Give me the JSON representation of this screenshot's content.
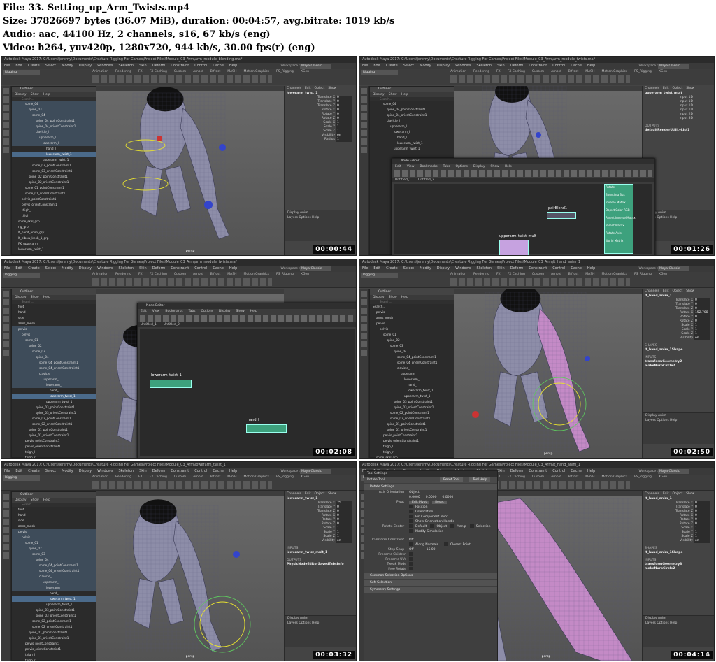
{
  "header": {
    "file": "File: 33. Setting_up_Arm_Twists.mp4",
    "size": "Size: 37826697 bytes (36.07 MiB), duration: 00:04:57, avg.bitrate: 1019 kb/s",
    "audio": "Audio: aac, 44100 Hz, 2 channels, s16, 67 kb/s (eng)",
    "video": "Video: h264, yuv420p, 1280x720, 944 kb/s, 30.00 fps(r) (eng)"
  },
  "maya": {
    "title_prefix": "Autodesk Maya 2017: C:\\Users\\jeremy\\Documents\\Creature Rigging For Games\\Project Files\\Module_03_Arm\\",
    "menus": [
      "File",
      "Edit",
      "Create",
      "Select",
      "Modify",
      "Display",
      "Windows",
      "Skeleton",
      "Skin",
      "Deform",
      "Constraint",
      "Control",
      "Cache",
      "Help"
    ],
    "shelf_tabs": [
      "Animation",
      "Rendering",
      "FX",
      "FX Caching",
      "Custom",
      "Arnold",
      "Bifrost",
      "MASH",
      "Motion Graphics",
      "PS_Rigging",
      "XGen"
    ],
    "mode": "Rigging",
    "workspace_label": "Workspace :",
    "workspace": "Maya Classic",
    "no_live": "No Live Surface",
    "outliner_title": "Outliner",
    "outliner_menu": [
      "Display",
      "Show",
      "Help"
    ],
    "search": "Search...",
    "viewport_label": "persp",
    "channel_menu": [
      "Channels",
      "Edit",
      "Object",
      "Show"
    ],
    "layer_tabs": [
      "Display",
      "Anim"
    ],
    "layer_menu": [
      "Layers",
      "Options",
      "Help"
    ],
    "attrs": [
      "Translate X",
      "Translate Y",
      "Translate Z",
      "Rotate X",
      "Rotate Y",
      "Rotate Z",
      "Scale X",
      "Scale Y",
      "Scale Z",
      "Visibility"
    ]
  },
  "thumbs": [
    {
      "timecode": "00:00:44",
      "file_tail": "arm_module_blending.ma*",
      "sel_obj": "lowerarm_twist_1",
      "chan_obj": "lowerarm_twist_1",
      "values": [
        "0",
        "0",
        "0",
        "0",
        "0",
        "0",
        "1",
        "1",
        "1",
        "on"
      ],
      "extra_attr": "Radius",
      "extra_val": "1",
      "outliner": [
        {
          "t": "spine_04",
          "d": 3,
          "c": "hi"
        },
        {
          "t": "spine_03",
          "d": 4,
          "c": "hi"
        },
        {
          "t": "spine_04",
          "d": 5,
          "c": "hi"
        },
        {
          "t": "spine_04_pointConstraint1",
          "d": 6,
          "c": "hi"
        },
        {
          "t": "spine_04_orientConstraint1",
          "d": 6,
          "c": "hi"
        },
        {
          "t": "clavicle_l",
          "d": 6,
          "c": "hi"
        },
        {
          "t": "upperarm_l",
          "d": 7,
          "c": "hi"
        },
        {
          "t": "lowerarm_l",
          "d": 8,
          "c": "hi"
        },
        {
          "t": "hand_l",
          "d": 9,
          "c": ""
        },
        {
          "t": "lowerarm_twist_1",
          "d": 9,
          "c": "sel"
        },
        {
          "t": "upperarm_twist_1",
          "d": 8,
          "c": ""
        },
        {
          "t": "spine_03_pointConstraint1",
          "d": 5,
          "c": ""
        },
        {
          "t": "spine_03_orientConstraint1",
          "d": 5,
          "c": ""
        },
        {
          "t": "spine_02_pointConstraint1",
          "d": 4,
          "c": ""
        },
        {
          "t": "spine_02_orientConstraint1",
          "d": 4,
          "c": ""
        },
        {
          "t": "spine_01_pointConstraint1",
          "d": 3,
          "c": ""
        },
        {
          "t": "spine_01_orientConstraint1",
          "d": 3,
          "c": ""
        },
        {
          "t": "pelvis_pointConstraint1",
          "d": 2,
          "c": ""
        },
        {
          "t": "pelvis_orientConstraint1",
          "d": 2,
          "c": ""
        },
        {
          "t": "thigh_l",
          "d": 2,
          "c": ""
        },
        {
          "t": "thigh_r",
          "d": 2,
          "c": ""
        },
        {
          "t": "spine_skel_grp",
          "d": 1,
          "c": ""
        },
        {
          "t": "rig_grp",
          "d": 1,
          "c": ""
        },
        {
          "t": "lt_hand_anim_grp1",
          "d": 1,
          "c": ""
        },
        {
          "t": "lt_elbow_knob_1_grp",
          "d": 1,
          "c": ""
        },
        {
          "t": "FK_upperarm",
          "d": 1,
          "c": ""
        },
        {
          "t": "lowerarm_twist_1",
          "d": 1,
          "c": ""
        }
      ]
    },
    {
      "timecode": "00:01:26",
      "file_tail": "arm_module_twists.ma*",
      "sel_obj": "upperarm_twist_mult",
      "chan_obj": "upperarm_twist_mult",
      "inputs": [
        "Input 1D",
        "Input 1D",
        "Input 1D",
        "Input 1D",
        "Input 2D",
        "Input 3D"
      ],
      "outputs_label": "OUTPUTS",
      "outputs_node": "defaultRenderUtilityList1",
      "node_editor_title": "Node Editor",
      "node_editor_menus": [
        "Edit",
        "View",
        "Bookmarks",
        "Tabs",
        "Options",
        "Display",
        "Show",
        "Help"
      ],
      "node_tabs": [
        "Untitled_1",
        "Untitled_2"
      ],
      "nodes": [
        "pairBlend1",
        "upperarm_twist_mult",
        "Rotate",
        "Bounding Box",
        "Inverse Matrix",
        "Object Color RGB",
        "Parent Inverse Matrix",
        "Parent Matrix",
        "Rotate Axis",
        "World Matrix"
      ]
    },
    {
      "timecode": "00:02:08",
      "file_tail": "arm_module_twists.ma*",
      "node_editor_title": "Node Editor",
      "node_editor_menus": [
        "Edit",
        "View",
        "Bookmarks",
        "Tabs",
        "Options",
        "Display",
        "Show",
        "Help"
      ],
      "node_tabs": [
        "Untitled_1",
        "Untitled_2"
      ],
      "node1": "lowerarm_twist_1",
      "node2": "hand_l",
      "outliner": [
        {
          "t": "foot",
          "d": 1,
          "c": ""
        },
        {
          "t": "hand",
          "d": 1,
          "c": ""
        },
        {
          "t": "side",
          "d": 1,
          "c": ""
        },
        {
          "t": "arms_mesh",
          "d": 1,
          "c": ""
        },
        {
          "t": "pelvis",
          "d": 1,
          "c": "hi"
        },
        {
          "t": "pelvis",
          "d": 2,
          "c": "hi"
        },
        {
          "t": "spine_01",
          "d": 3,
          "c": "hi"
        },
        {
          "t": "spine_02",
          "d": 4,
          "c": "hi"
        },
        {
          "t": "spine_03",
          "d": 5,
          "c": "hi"
        },
        {
          "t": "spine_04",
          "d": 6,
          "c": "hi"
        },
        {
          "t": "spine_04_pointConstraint1",
          "d": 7,
          "c": "hi"
        },
        {
          "t": "spine_04_orientConstraint1",
          "d": 7,
          "c": "hi"
        },
        {
          "t": "clavicle_l",
          "d": 7,
          "c": "hi"
        },
        {
          "t": "upperarm_l",
          "d": 8,
          "c": "hi"
        },
        {
          "t": "lowerarm_l",
          "d": 9,
          "c": "hi"
        },
        {
          "t": "hand_l",
          "d": 10,
          "c": ""
        },
        {
          "t": "lowerarm_twist_1",
          "d": 10,
          "c": "sel"
        },
        {
          "t": "upperarm_twist_1",
          "d": 9,
          "c": ""
        },
        {
          "t": "spine_03_pointConstraint1",
          "d": 6,
          "c": ""
        },
        {
          "t": "spine_03_orientConstraint1",
          "d": 6,
          "c": ""
        },
        {
          "t": "spine_02_pointConstraint1",
          "d": 5,
          "c": ""
        },
        {
          "t": "spine_02_orientConstraint1",
          "d": 5,
          "c": ""
        },
        {
          "t": "spine_01_pointConstraint1",
          "d": 4,
          "c": ""
        },
        {
          "t": "spine_01_orientConstraint1",
          "d": 4,
          "c": ""
        },
        {
          "t": "pelvis_pointConstraint1",
          "d": 3,
          "c": ""
        },
        {
          "t": "pelvis_orientConstraint1",
          "d": 3,
          "c": ""
        },
        {
          "t": "thigh_l",
          "d": 3,
          "c": ""
        },
        {
          "t": "thigh_r",
          "d": 3,
          "c": ""
        },
        {
          "t": "spine_skel_grp",
          "d": 1,
          "c": ""
        }
      ]
    },
    {
      "timecode": "00:02:50",
      "file_tail": "lt_hand_anim_1",
      "chan_obj": "lt_hand_anim_1",
      "values": [
        "0",
        "0",
        "0",
        "152.708",
        "0",
        "0",
        "1",
        "1",
        "1",
        "on"
      ],
      "shapes_label": "SHAPES",
      "shape_node": "lt_hand_anim_1Shape",
      "inputs_label": "INPUTS",
      "input_nodes": [
        "transformGeometry2",
        "makeNurbCircle2"
      ],
      "outliner": [
        {
          "t": "Search...",
          "d": 0,
          "c": ""
        },
        {
          "t": "pelvis",
          "d": 1,
          "c": ""
        },
        {
          "t": "arms_mesh",
          "d": 1,
          "c": ""
        },
        {
          "t": "pelvis",
          "d": 1,
          "c": ""
        },
        {
          "t": "pelvis",
          "d": 2,
          "c": ""
        },
        {
          "t": "spine_01",
          "d": 3,
          "c": ""
        },
        {
          "t": "spine_02",
          "d": 4,
          "c": ""
        },
        {
          "t": "spine_03",
          "d": 5,
          "c": ""
        },
        {
          "t": "spine_04",
          "d": 6,
          "c": ""
        },
        {
          "t": "spine_04_pointConstraint1",
          "d": 7,
          "c": ""
        },
        {
          "t": "spine_04_orientConstraint1",
          "d": 7,
          "c": ""
        },
        {
          "t": "clavicle_l",
          "d": 7,
          "c": ""
        },
        {
          "t": "upperarm_l",
          "d": 8,
          "c": ""
        },
        {
          "t": "lowerarm_l",
          "d": 9,
          "c": ""
        },
        {
          "t": "hand_l",
          "d": 10,
          "c": ""
        },
        {
          "t": "lowerarm_twist_1",
          "d": 10,
          "c": ""
        },
        {
          "t": "upperarm_twist_1",
          "d": 9,
          "c": ""
        },
        {
          "t": "spine_03_pointConstraint1",
          "d": 6,
          "c": ""
        },
        {
          "t": "spine_03_orientConstraint1",
          "d": 6,
          "c": ""
        },
        {
          "t": "spine_02_pointConstraint1",
          "d": 5,
          "c": ""
        },
        {
          "t": "spine_02_orientConstraint1",
          "d": 5,
          "c": ""
        },
        {
          "t": "spine_01_pointConstraint1",
          "d": 4,
          "c": ""
        },
        {
          "t": "spine_01_orientConstraint1",
          "d": 4,
          "c": ""
        },
        {
          "t": "pelvis_pointConstraint1",
          "d": 3,
          "c": ""
        },
        {
          "t": "pelvis_orientConstraint1",
          "d": 3,
          "c": ""
        },
        {
          "t": "thigh_l",
          "d": 3,
          "c": ""
        },
        {
          "t": "thigh_r",
          "d": 3,
          "c": ""
        },
        {
          "t": "spine_skel_grp",
          "d": 1,
          "c": ""
        }
      ]
    },
    {
      "timecode": "00:03:32",
      "file_tail": "lowerarm_twist_1",
      "chan_obj": "lowerarm_twist_1",
      "values": [
        "25",
        "0",
        "0",
        "0",
        "0",
        "0",
        "1",
        "1",
        "1",
        "on"
      ],
      "inputs_label": "INPUTS",
      "input_node": "lowerarm_twist_mult_1",
      "outputs_label": "OUTPUTS",
      "output_node": "PhysicNodeEditorSavedTabsInfo",
      "outliner": [
        {
          "t": "foot",
          "d": 1,
          "c": ""
        },
        {
          "t": "hand",
          "d": 1,
          "c": ""
        },
        {
          "t": "side",
          "d": 1,
          "c": ""
        },
        {
          "t": "arms_mesh",
          "d": 1,
          "c": ""
        },
        {
          "t": "pelvis",
          "d": 1,
          "c": "hi"
        },
        {
          "t": "pelvis",
          "d": 2,
          "c": "hi"
        },
        {
          "t": "spine_01",
          "d": 3,
          "c": "hi"
        },
        {
          "t": "spine_02",
          "d": 4,
          "c": "hi"
        },
        {
          "t": "spine_03",
          "d": 5,
          "c": "hi"
        },
        {
          "t": "spine_04",
          "d": 6,
          "c": "hi"
        },
        {
          "t": "spine_04_pointConstraint1",
          "d": 7,
          "c": "hi"
        },
        {
          "t": "spine_04_orientConstraint1",
          "d": 7,
          "c": "hi"
        },
        {
          "t": "clavicle_l",
          "d": 7,
          "c": "hi"
        },
        {
          "t": "upperarm_l",
          "d": 8,
          "c": "hi"
        },
        {
          "t": "lowerarm_l",
          "d": 9,
          "c": "hi"
        },
        {
          "t": "hand_l",
          "d": 10,
          "c": ""
        },
        {
          "t": "lowerarm_twist_1",
          "d": 10,
          "c": "sel"
        },
        {
          "t": "upperarm_twist_1",
          "d": 9,
          "c": ""
        },
        {
          "t": "spine_03_pointConstraint1",
          "d": 6,
          "c": ""
        },
        {
          "t": "spine_03_orientConstraint1",
          "d": 6,
          "c": ""
        },
        {
          "t": "spine_02_pointConstraint1",
          "d": 5,
          "c": ""
        },
        {
          "t": "spine_02_orientConstraint1",
          "d": 5,
          "c": ""
        },
        {
          "t": "spine_01_pointConstraint1",
          "d": 4,
          "c": ""
        },
        {
          "t": "spine_01_orientConstraint1",
          "d": 4,
          "c": ""
        },
        {
          "t": "pelvis_pointConstraint1",
          "d": 3,
          "c": ""
        },
        {
          "t": "pelvis_orientConstraint1",
          "d": 3,
          "c": ""
        },
        {
          "t": "thigh_l",
          "d": 3,
          "c": ""
        },
        {
          "t": "thigh_r",
          "d": 3,
          "c": ""
        },
        {
          "t": "spine_skel_grp",
          "d": 1,
          "c": ""
        }
      ]
    },
    {
      "timecode": "00:04:14",
      "file_tail": "lt_hand_anim_1",
      "chan_obj": "lt_hand_anim_1",
      "values": [
        "0",
        "0",
        "0",
        "0",
        "0",
        "0",
        "1",
        "1",
        "1",
        "on"
      ],
      "shapes_label": "SHAPES",
      "shape_node": "lt_hand_anim_1Shape",
      "inputs_label": "INPUTS",
      "input_nodes": [
        "transformGeometry3",
        "makeNurbCircle2"
      ],
      "tool_settings": {
        "title": "Tool Settings",
        "tool": "Rotate Tool",
        "reset": "Reset Tool",
        "help": "Tool Help",
        "section": "Rotate Settings",
        "axis_label": "Axis Orientation :",
        "axis_value": "Object",
        "coords": [
          "0.0000",
          "0.0000",
          "0.0000"
        ],
        "pivot_label": "Pivot :",
        "edit_pivot": "Edit Pivot",
        "reset_btn": "Reset",
        "options": [
          "Position",
          "Orientation",
          "Pin Component Pivot",
          "Show Orientation Handle"
        ],
        "rotate_center_label": "Rotate Center :",
        "rotate_center": [
          "Default",
          "Object",
          "Manip",
          "Selection"
        ],
        "modify_simulation": "Modify Simulation",
        "transform_constraint": "Transform Constraint :",
        "off1": "Off",
        "along_normals": "Along Normals",
        "closest_point": "Closest Point",
        "step_snap": "Step Snap :",
        "off2": "Off",
        "step_value": "15.00",
        "extras": [
          "Preserve Children",
          "Preserve UVs",
          "Tweak Mode",
          "Free Rotate"
        ],
        "collapsed": [
          "Common Selection Options",
          "Soft Selection",
          "Symmetry Settings"
        ]
      }
    }
  ]
}
